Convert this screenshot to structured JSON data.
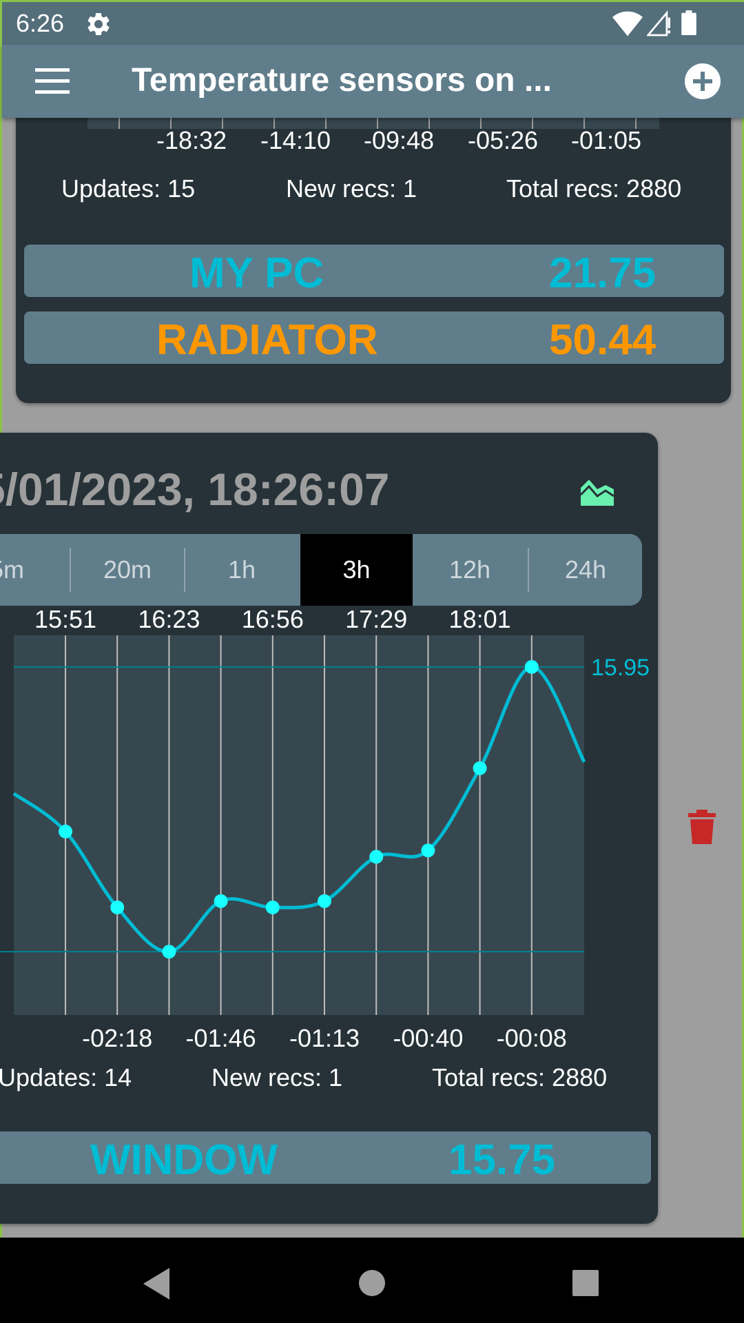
{
  "status_bar": {
    "time": "6:26",
    "icons": [
      "gear-icon",
      "wifi-icon",
      "signal-icon",
      "battery-icon"
    ]
  },
  "app_bar": {
    "title": "Temperature sensors on ...",
    "menu_icon": "menu-icon",
    "add_icon": "add-circle-icon"
  },
  "card1": {
    "tick_labels": [
      "-18:32",
      "-14:10",
      "-09:48",
      "-05:26",
      "-01:05"
    ],
    "stats": {
      "updates": "Updates: 15",
      "new_recs": "New recs: 1",
      "total_recs": "Total recs: 2880"
    },
    "sensors": [
      {
        "name": "MY PC",
        "value": "21.75",
        "color": "#00bcd4"
      },
      {
        "name": "RADIATOR",
        "value": "50.44",
        "color": "#ff9800"
      }
    ]
  },
  "card2": {
    "date_title": "5/01/2023, 18:26:07",
    "chart_icon": "area-chart-icon",
    "range_tabs": [
      {
        "label": "5m",
        "selected": false
      },
      {
        "label": "20m",
        "selected": false
      },
      {
        "label": "1h",
        "selected": false
      },
      {
        "label": "3h",
        "selected": true
      },
      {
        "label": "12h",
        "selected": false
      },
      {
        "label": "24h",
        "selected": false
      }
    ],
    "stats": {
      "updates": "Updates: 14",
      "new_recs": "New recs: 1",
      "total_recs": "Total recs: 2880"
    },
    "sensors": [
      {
        "name": "WINDOW",
        "value": "15.75",
        "color": "#00bcd4"
      }
    ],
    "trash_icon": "trash-icon"
  },
  "chart_data": {
    "type": "line",
    "top_tick_labels": [
      "15:51",
      "16:23",
      "16:56",
      "17:29",
      "18:01"
    ],
    "bottom_tick_labels": [
      "-02:18",
      "-01:46",
      "-01:13",
      "-00:40",
      "-00:08"
    ],
    "max_label": "15.95",
    "ylim": [
      15.4,
      16.0
    ],
    "points": [
      15.69,
      15.57,
      15.5,
      15.58,
      15.57,
      15.58,
      15.65,
      15.66,
      15.79,
      15.95
    ],
    "first_value": 15.75,
    "last_value": 15.8,
    "min_line_value": 15.5,
    "max_line_value": 15.95,
    "grid": true,
    "line_color": "#00bcd4",
    "point_color": "#18ffff"
  },
  "nav_bar": {
    "icons": [
      "back-icon",
      "home-icon",
      "recents-icon"
    ]
  }
}
